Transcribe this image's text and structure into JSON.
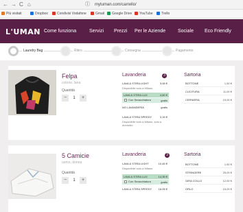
{
  "browser": {
    "nav": [
      "←",
      "→",
      "C",
      "⌂"
    ],
    "url": "mytuman.com/carrello/",
    "bookmarks": [
      {
        "label": "Più visitati",
        "color": "#e07b2a"
      },
      {
        "label": "Dropbox",
        "color": "#1a6fd8"
      },
      {
        "label": "Condivisi Vodafone",
        "color": "#d8362a"
      },
      {
        "label": "Gmail",
        "color": "#d8362a"
      },
      {
        "label": "Google Drive",
        "color": "#1a9a54"
      },
      {
        "label": "YouTube",
        "color": "#d8362a"
      },
      {
        "label": "Trello",
        "color": "#1a6fd8"
      }
    ]
  },
  "header": {
    "logo": "L'UMAN",
    "nav": [
      "Come funziona",
      "Servizi",
      "Prezzi",
      "Per le Aziende",
      "Sociale",
      "Eco Friendly"
    ]
  },
  "steps": [
    "Laundry Bag",
    "Ritiro",
    "Consegna",
    "Pagamento"
  ],
  "items": [
    {
      "name": "Felpa",
      "sub": "cotone, lana",
      "qty_label": "Quantità",
      "qty": "1",
      "lavanderia_title": "Lavanderia",
      "lavanderia_badge": "3",
      "lavanderia": [
        {
          "name": "LAVA & STIRA LIGHT",
          "price": "3,06 €",
          "note": "Disponibile solo a Milano"
        },
        {
          "name": "LAVA & STIRA LUX",
          "price": "4,60 €",
          "highlight": true,
          "check": "Con Smacchiatura",
          "check_price": "gratis"
        },
        {
          "name": "NO LAVANDERIA",
          "price": "gratis"
        },
        {
          "name": "LAVA & STIRA SPEEDY",
          "price": "3,15 €",
          "note": "Disponibile solo a Milano, solo a domicilio"
        }
      ],
      "sartoria_title": "Sartoria",
      "sartoria": [
        {
          "name": "BOTTONE",
          "price": "1,50 €"
        },
        {
          "name": "CUCITURA",
          "price": "11,00 €"
        },
        {
          "name": "CERNIERA",
          "price": "15,00 €"
        }
      ]
    },
    {
      "name": "5 Camicie",
      "sub": "uomo, donna",
      "qty_label": "Quantità",
      "qty": "1",
      "lavanderia_title": "Lavanderia",
      "lavanderia_badge": "3",
      "lavanderia": [
        {
          "name": "LAVA & STIRA LIGHT",
          "price": "10,45 €",
          "note": "Disponibile solo a Milano"
        },
        {
          "name": "LAVA & STIRA LUX",
          "price": "14,35 €",
          "highlight": true,
          "check": "Con Smacchiatura",
          "check_price": "gratis"
        },
        {
          "name": "LAVA & STIRA SPEEDY",
          "price": "16,05 €"
        }
      ],
      "sartoria_title": "Sartoria",
      "sartoria": [
        {
          "name": "BOTTONE",
          "price": "1,50 €"
        },
        {
          "name": "STRINGERE",
          "price": "25,00 €"
        },
        {
          "name": "GIRA COLLO",
          "price": "12,00 €"
        },
        {
          "name": "ORLO",
          "price": "15,00 €"
        }
      ]
    }
  ]
}
